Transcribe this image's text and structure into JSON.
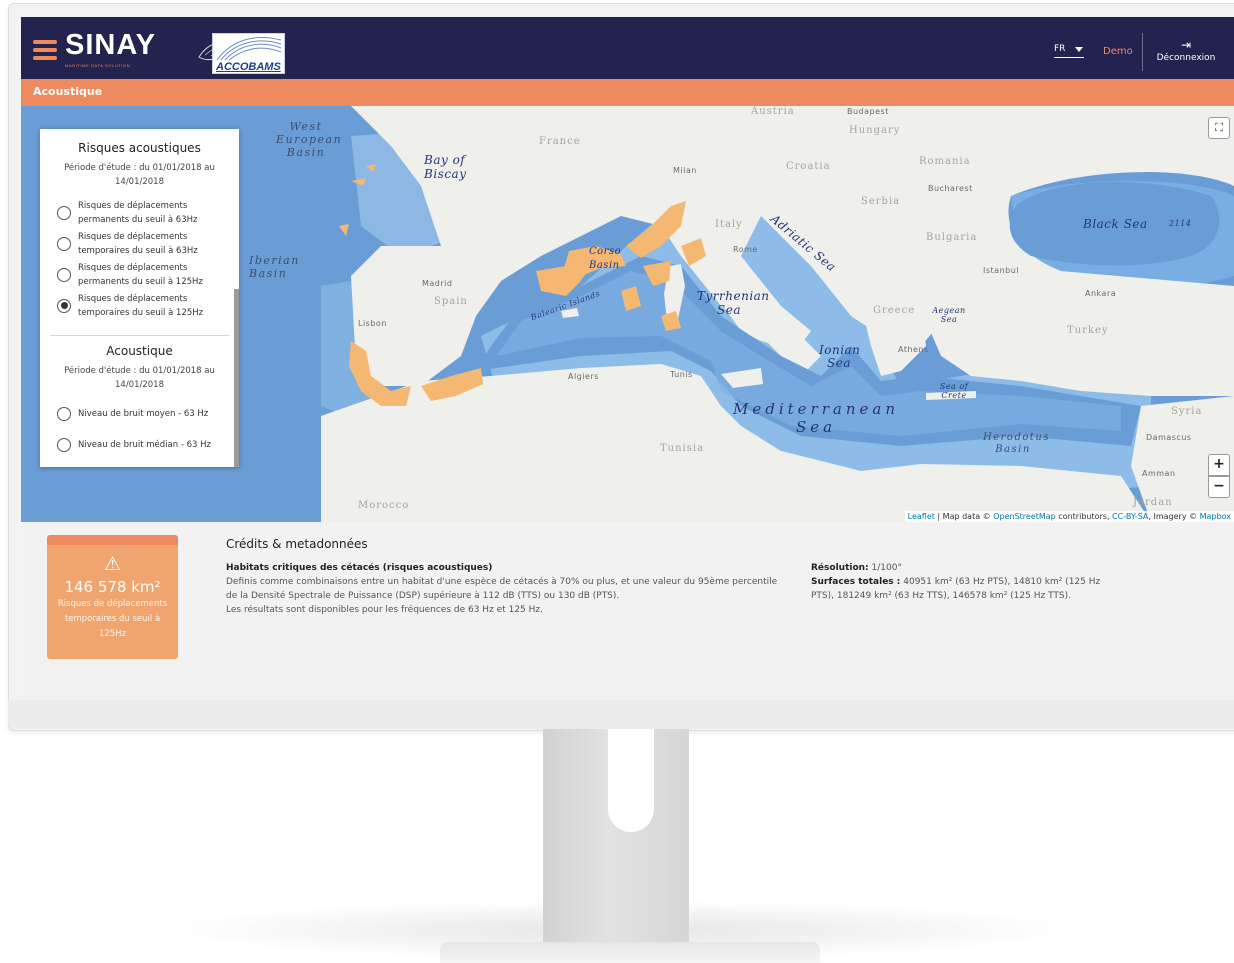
{
  "header": {
    "brand": "SINAY",
    "brand_tagline": "MARITIME DATA SOLUTION",
    "partner_logo_text": "ACCOBAMS",
    "language": "FR",
    "user": "Demo",
    "logout_label": "Déconnexion",
    "logout_icon": "logout-icon",
    "menu_icon": "hamburger-icon"
  },
  "section": {
    "title": "Acoustique"
  },
  "map": {
    "sea_labels": {
      "west_european_basin": "West European Basin",
      "bay_of_biscay": "Bay of Biscay",
      "iberian_basin": "Iberian Basin",
      "corso_basin": "Corso Basin",
      "balearic_islands": "Balearic Islands",
      "tyrrhenian_sea": "Tyrrhenian Sea",
      "adriatic_sea": "Adriatic Sea",
      "ionian_sea": "Ionian Sea",
      "aegean_sea": "Aegean Sea",
      "sea_of_crete": "Sea of Crete",
      "mediterranean_sea": "Mediterranean Sea",
      "herodotus_basin": "Herodotus Basin",
      "black_sea": "Black Sea",
      "black_sea_depth": "2114"
    },
    "land_labels": {
      "france": "France",
      "spain": "Spain",
      "italy": "Italy",
      "croatia": "Croatia",
      "serbia": "Serbia",
      "romania": "Romania",
      "bulgaria": "Bulgaria",
      "hungary": "Hungary",
      "austria": "Austria",
      "greece": "Greece",
      "turkey": "Turkey",
      "syria": "Syria",
      "tunisia": "Tunisia",
      "morocco": "Morocco",
      "jordan": "Jordan"
    },
    "city_labels": {
      "budapest": "Budapest",
      "bucharest": "Bucharest",
      "milan": "Milan",
      "rome": "Rome",
      "madrid": "Madrid",
      "lisbon": "Lisbon",
      "algiers": "Algiers",
      "tunis": "Tunis",
      "athens": "Athens",
      "istanbul": "Istanbul",
      "ankara": "Ankara",
      "damascus": "Damascus",
      "amman": "Amman"
    },
    "controls": {
      "zoom_in": "+",
      "zoom_out": "−",
      "fullscreen_icon": "fullscreen-icon"
    },
    "attribution": {
      "leaflet": "Leaflet",
      "sep1": " | Map data © ",
      "osm": "OpenStreetMap",
      "mid": " contributors, ",
      "license": "CC-BY-SA",
      "imagery": ", Imagery © ",
      "mapbox": "Mapbox"
    },
    "colors": {
      "sea": "#6a9cd6",
      "shelf": "#a8c9ea",
      "land": "#efefeb",
      "risk": "#f5b872"
    }
  },
  "legend": {
    "group1_title": "Risques acoustiques",
    "group1_period": "Période d'étude : du 01/01/2018 au 14/01/2018",
    "group1_options": [
      {
        "label": "Risques de déplacements permanents du seuil à 63Hz",
        "checked": false
      },
      {
        "label": "Risques de déplacements temporaires du seuil à 63Hz",
        "checked": false
      },
      {
        "label": "Risques de déplacements permanents du seuil à 125Hz",
        "checked": false
      },
      {
        "label": "Risques de déplacements temporaires du seuil à 125Hz",
        "checked": true
      }
    ],
    "group2_title": "Acoustique",
    "group2_period": "Période d'étude : du 01/01/2018 au 14/01/2018",
    "group2_options": [
      {
        "label": "Niveau de bruit moyen - 63 Hz",
        "checked": false
      },
      {
        "label": "Niveau de bruit médian - 63 Hz",
        "checked": false
      }
    ]
  },
  "kpi": {
    "icon": "warning-icon",
    "value": "146 578 km²",
    "label": "Risques de déplacements temporaires du seuil à 125Hz"
  },
  "credits": {
    "title": "Crédits & metadonnées",
    "habitat_title": "Habitats critiques des cétacés (risques acoustiques)",
    "habitat_desc": "Definis comme combinaisons entre un habitat d'une espèce de cétacés à 70% ou plus, et une valeur du 95ème percentile de la Densité Spectrale de Puissance (DSP) supérieure à 112 dB (TTS) ou 130 dB (PTS).",
    "habitat_note": "Les résultats sont disponibles pour les fréquences de 63 Hz et 125 Hz.",
    "resolution_label": "Résolution:",
    "resolution_value": " 1/100°",
    "surfaces_label": "Surfaces totales :",
    "surfaces_value": " 40951 km² (63 Hz PTS), 14810 km² (125 Hz PTS), 181249 km² (63 Hz TTS), 146578 km² (125 Hz TTS)."
  }
}
